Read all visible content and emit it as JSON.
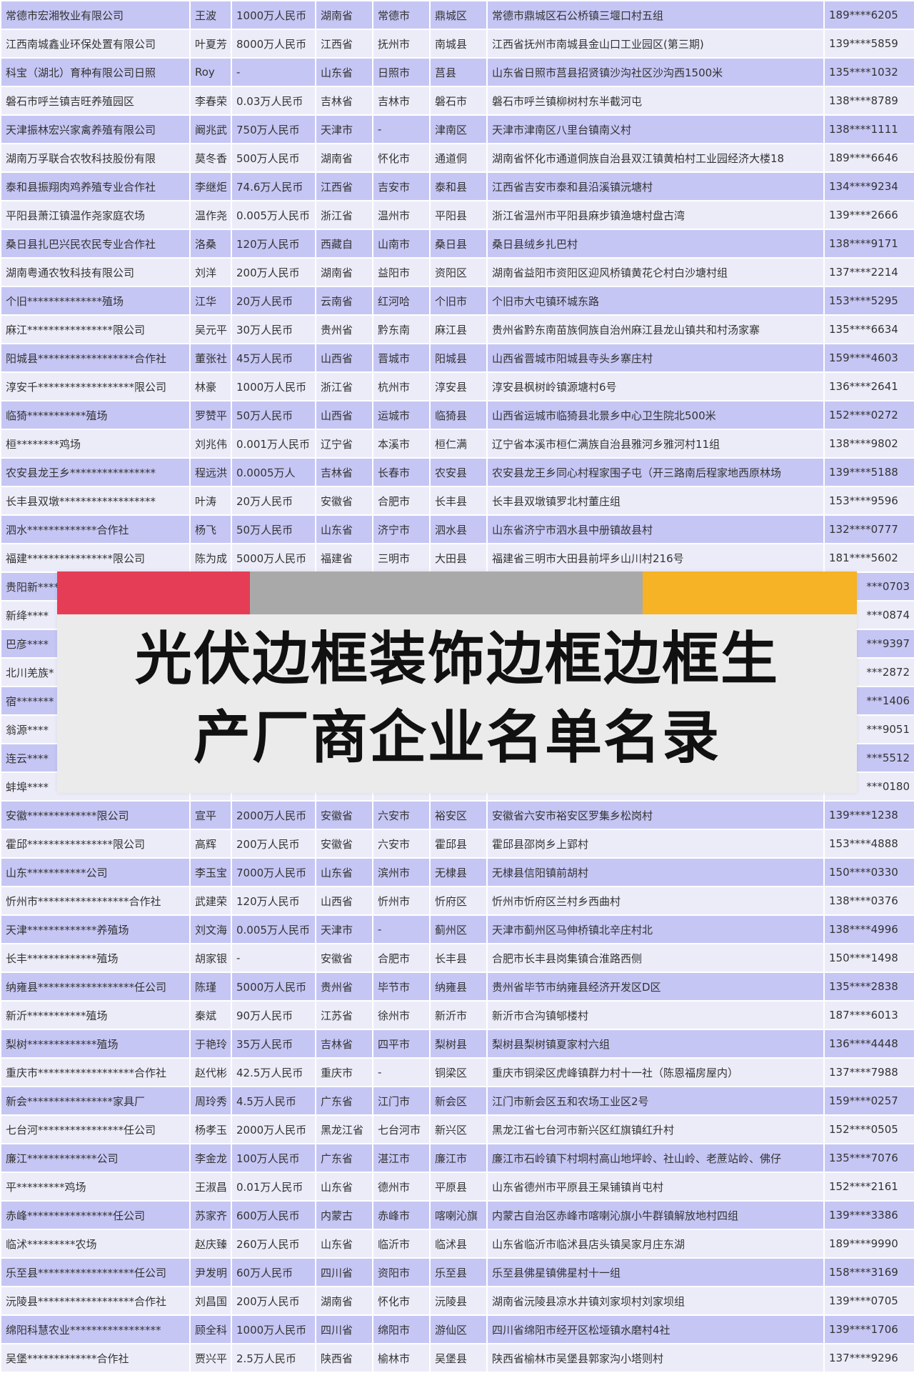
{
  "banner": {
    "title_line1": "光伏边框装饰边框边框生",
    "title_line2": "产厂商企业名单名录",
    "colors": [
      "#e63d57",
      "#a9a9a9",
      "#f5b325"
    ]
  },
  "rows": [
    [
      "常德市宏湘牧业有限公司",
      "王波",
      "1000万人民币",
      "湖南省",
      "常德市",
      "鼎城区",
      "常德市鼎城区石公桥镇三堰口村五组",
      "189****6205"
    ],
    [
      "江西南城鑫业环保处置有限公司",
      "叶夏芳",
      "8000万人民币",
      "江西省",
      "抚州市",
      "南城县",
      "江西省抚州市南城县金山口工业园区(第三期)",
      "139****5859"
    ],
    [
      "科宝（湖北）育种有限公司日照",
      "Roy",
      "-",
      "山东省",
      "日照市",
      "莒县",
      "山东省日照市莒县招贤镇沙沟社区沙沟西1500米",
      "135****1032"
    ],
    [
      "磐石市呼兰镇吉旺养殖园区",
      "李春荣",
      "0.03万人民币",
      "吉林省",
      "吉林市",
      "磐石市",
      "磐石市呼兰镇柳树村东半截河屯",
      "138****8789"
    ],
    [
      "天津振林宏兴家禽养殖有限公司",
      "阚兆武",
      "750万人民币",
      "天津市",
      "-",
      "津南区",
      "天津市津南区八里台镇南义村",
      "138****1111"
    ],
    [
      "湖南万孚联合农牧科技股份有限",
      "莫冬香",
      "500万人民币",
      "湖南省",
      "怀化市",
      "通道侗",
      "湖南省怀化市通道侗族自治县双江镇黄柏村工业园经济大楼18",
      "189****6646"
    ],
    [
      "泰和县振翔肉鸡养殖专业合作社",
      "李继炬",
      "74.6万人民币",
      "江西省",
      "吉安市",
      "泰和县",
      "江西省吉安市泰和县沿溪镇沅塘村",
      "134****9234"
    ],
    [
      "平阳县萧江镇温作尧家庭农场",
      "温作尧",
      "0.005万人民币",
      "浙江省",
      "温州市",
      "平阳县",
      "浙江省温州市平阳县麻步镇渔塘村盘古湾",
      "139****2666"
    ],
    [
      "桑日县扎巴兴民农民专业合作社",
      "洛桑",
      "120万人民币",
      "西藏自",
      "山南市",
      "桑日县",
      "桑日县绒乡扎巴村",
      "138****9171"
    ],
    [
      "湖南粤通农牧科技有限公司",
      "刘洋",
      "200万人民币",
      "湖南省",
      "益阳市",
      "资阳区",
      "湖南省益阳市资阳区迎风桥镇黄花仑村白沙塘村组",
      "137****2214"
    ],
    [
      "个旧**************殖场",
      "江华",
      "20万人民币",
      "云南省",
      "红河哈",
      "个旧市",
      "个旧市大屯镇环城东路",
      "153****5295"
    ],
    [
      "麻江****************限公司",
      "吴元平",
      "30万人民币",
      "贵州省",
      "黔东南",
      "麻江县",
      "贵州省黔东南苗族侗族自治州麻江县龙山镇共和村汤家寨",
      "135****6634"
    ],
    [
      "阳城县******************合作社",
      "董张社",
      "45万人民币",
      "山西省",
      "晋城市",
      "阳城县",
      "山西省晋城市阳城县寺头乡寨庄村",
      "159****4603"
    ],
    [
      "淳安千******************限公司",
      "林豪",
      "1000万人民币",
      "浙江省",
      "杭州市",
      "淳安县",
      "淳安县枫树岭镇源塘村6号",
      "136****2641"
    ],
    [
      "临猗***********殖场",
      "罗赞平",
      "50万人民币",
      "山西省",
      "运城市",
      "临猗县",
      "山西省运城市临猗县北景乡中心卫生院北500米",
      "152****0272"
    ],
    [
      "桓********鸡场",
      "刘兆伟",
      "0.001万人民币",
      "辽宁省",
      "本溪市",
      "桓仁满",
      "辽宁省本溪市桓仁满族自治县雅河乡雅河村11组",
      "138****9802"
    ],
    [
      "农安县龙王乡****************",
      "程远洪",
      "0.0005万人",
      "吉林省",
      "长春市",
      "农安县",
      "农安县龙王乡同心村程家围子屯（开三路南后程家地西原林场",
      "139****5188"
    ],
    [
      "长丰县双墩******************",
      "叶涛",
      "20万人民币",
      "安徽省",
      "合肥市",
      "长丰县",
      "长丰县双墩镇罗北村董庄组",
      "153****9596"
    ],
    [
      "泗水*************合作社",
      "杨飞",
      "50万人民币",
      "山东省",
      "济宁市",
      "泗水县",
      "山东省济宁市泗水县中册镇故县村",
      "132****0777"
    ],
    [
      "福建****************限公司",
      "陈为成",
      "5000万人民币",
      "福建省",
      "三明市",
      "大田县",
      "福建省三明市大田县前坪乡山川村216号",
      "181****5602"
    ],
    [
      "贵阳新****",
      "",
      "",
      "",
      "",
      "",
      "",
      "***0703"
    ],
    [
      "新绛****",
      "",
      "",
      "",
      "",
      "",
      "",
      "***0874"
    ],
    [
      "巴彦****",
      "",
      "",
      "",
      "",
      "",
      "",
      "***9397"
    ],
    [
      "北川羌族*",
      "",
      "",
      "",
      "",
      "",
      "",
      "***2872"
    ],
    [
      "宿*******",
      "",
      "",
      "",
      "",
      "",
      "",
      "***1406"
    ],
    [
      "翁源****",
      "",
      "",
      "",
      "",
      "",
      "",
      "***9051"
    ],
    [
      "连云****",
      "",
      "",
      "",
      "",
      "",
      "",
      "***5512"
    ],
    [
      "蚌埠****",
      "",
      "",
      "",
      "",
      "",
      "",
      "***0180"
    ],
    [
      "安徽*************限公司",
      "宣平",
      "2000万人民币",
      "安徽省",
      "六安市",
      "裕安区",
      "安徽省六安市裕安区罗集乡松岗村",
      "139****1238"
    ],
    [
      "霍邱****************限公司",
      "高辉",
      "200万人民币",
      "安徽省",
      "六安市",
      "霍邱县",
      "霍邱县邵岗乡上郢村",
      "153****4888"
    ],
    [
      "山东***********公司",
      "李玉宝",
      "7000万人民币",
      "山东省",
      "滨州市",
      "无棣县",
      "无棣县信阳镇前胡村",
      "150****0330"
    ],
    [
      "忻州市*****************合作社",
      "武建荣",
      "120万人民币",
      "山西省",
      "忻州市",
      "忻府区",
      "忻州市忻府区兰村乡西曲村",
      "138****0376"
    ],
    [
      "天津*************养殖场",
      "刘文海",
      "0.005万人民币",
      "天津市",
      "-",
      "蓟州区",
      "天津市蓟州区马伸桥镇北辛庄村北",
      "138****4996"
    ],
    [
      "长丰*************殖场",
      "胡家银",
      "-",
      "安徽省",
      "合肥市",
      "长丰县",
      "合肥市长丰县岗集镇合淮路西侧",
      "150****1498"
    ],
    [
      "纳雍县******************任公司",
      "陈瑾",
      "5000万人民币",
      "贵州省",
      "毕节市",
      "纳雍县",
      "贵州省毕节市纳雍县经济开发区D区",
      "135****2838"
    ],
    [
      "新沂***********殖场",
      "秦斌",
      "90万人民币",
      "江苏省",
      "徐州市",
      "新沂市",
      "新沂市合沟镇郇楼村",
      "187****6013"
    ],
    [
      "梨树*************殖场",
      "于艳玲",
      "35万人民币",
      "吉林省",
      "四平市",
      "梨树县",
      "梨树县梨树镇夏家村六组",
      "136****4448"
    ],
    [
      "重庆市******************合作社",
      "赵代彬",
      "42.5万人民币",
      "重庆市",
      "-",
      "铜梁区",
      "重庆市铜梁区虎峰镇群力村十一社（陈恩福房屋内）",
      "137****7988"
    ],
    [
      "新会****************家具厂",
      "周玲秀",
      "4.5万人民币",
      "广东省",
      "江门市",
      "新会区",
      "江门市新会区五和农场工业区2号",
      "159****0257"
    ],
    [
      "七台河****************任公司",
      "杨孝玉",
      "2000万人民币",
      "黑龙江省",
      "七台河市",
      "新兴区",
      "黑龙江省七台河市新兴区红旗镇红升村",
      "152****0505"
    ],
    [
      "廉江*************公司",
      "李金龙",
      "100万人民币",
      "广东省",
      "湛江市",
      "廉江市",
      "廉江市石岭镇下村垌村高山地坪岭、社山岭、老蔗站岭、佛仔",
      "135****7076"
    ],
    [
      "平*********鸡场",
      "王淑昌",
      "0.01万人民币",
      "山东省",
      "德州市",
      "平原县",
      "山东省德州市平原县王杲铺镇肖屯村",
      "152****2161"
    ],
    [
      "赤峰****************任公司",
      "苏家齐",
      "600万人民币",
      "内蒙古",
      "赤峰市",
      "喀喇沁旗",
      "内蒙古自治区赤峰市喀喇沁旗小牛群镇解放地村四组",
      "139****3386"
    ],
    [
      "临沭*********农场",
      "赵庆臻",
      "260万人民币",
      "山东省",
      "临沂市",
      "临沭县",
      "山东省临沂市临沭县店头镇吴家月庄东湖",
      "189****9990"
    ],
    [
      "乐至县******************任公司",
      "尹发明",
      "60万人民币",
      "四川省",
      "资阳市",
      "乐至县",
      "乐至县佛星镇佛星村十一组",
      "158****3169"
    ],
    [
      "沅陵县******************合作社",
      "刘昌国",
      "200万人民币",
      "湖南省",
      "怀化市",
      "沅陵县",
      "湖南省沅陵县凉水井镇刘家坝村刘家坝组",
      "139****0705"
    ],
    [
      "绵阳科慧农业*****************",
      "顾全科",
      "1000万人民币",
      "四川省",
      "绵阳市",
      "游仙区",
      "四川省绵阳市经开区松垭镇水磨村4社",
      "139****1706"
    ],
    [
      "吴堡*************合作社",
      "贾兴平",
      "2.5万人民币",
      "陕西省",
      "榆林市",
      "吴堡县",
      "陕西省榆林市吴堡县郭家沟小塔则村",
      "137****9296"
    ]
  ]
}
